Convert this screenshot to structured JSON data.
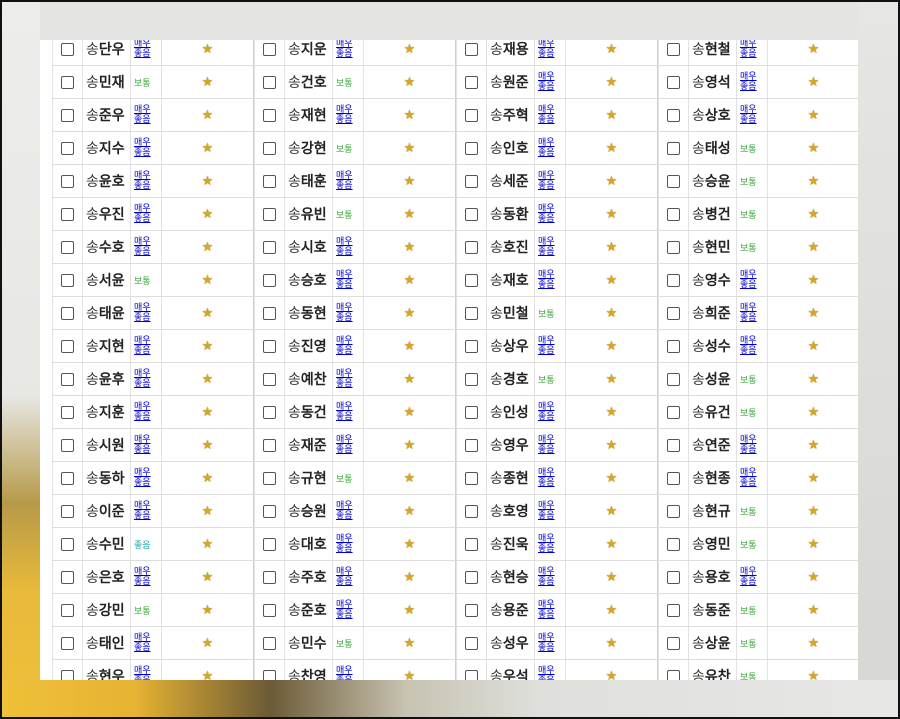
{
  "surname": "송",
  "rating_labels": {
    "very_good_1": "매우",
    "very_good_2": "좋음",
    "normal": "보통",
    "good": "좋음"
  },
  "columns": [
    [
      {
        "name": "단우",
        "rating": "vg"
      },
      {
        "name": "민재",
        "rating": "n"
      },
      {
        "name": "준우",
        "rating": "vg"
      },
      {
        "name": "지수",
        "rating": "vg"
      },
      {
        "name": "윤호",
        "rating": "vg"
      },
      {
        "name": "우진",
        "rating": "vg"
      },
      {
        "name": "수호",
        "rating": "vg"
      },
      {
        "name": "서윤",
        "rating": "n"
      },
      {
        "name": "태윤",
        "rating": "vg"
      },
      {
        "name": "지현",
        "rating": "vg"
      },
      {
        "name": "윤후",
        "rating": "vg"
      },
      {
        "name": "지훈",
        "rating": "vg"
      },
      {
        "name": "시원",
        "rating": "vg"
      },
      {
        "name": "동하",
        "rating": "vg"
      },
      {
        "name": "이준",
        "rating": "vg"
      },
      {
        "name": "수민",
        "rating": "g"
      },
      {
        "name": "은호",
        "rating": "vg"
      },
      {
        "name": "강민",
        "rating": "n"
      },
      {
        "name": "태인",
        "rating": "vg"
      },
      {
        "name": "현우",
        "rating": "vg"
      }
    ],
    [
      {
        "name": "지운",
        "rating": "vg"
      },
      {
        "name": "건호",
        "rating": "n"
      },
      {
        "name": "재현",
        "rating": "vg"
      },
      {
        "name": "강현",
        "rating": "n"
      },
      {
        "name": "태훈",
        "rating": "vg"
      },
      {
        "name": "유빈",
        "rating": "n"
      },
      {
        "name": "시호",
        "rating": "vg"
      },
      {
        "name": "승호",
        "rating": "vg"
      },
      {
        "name": "동현",
        "rating": "vg"
      },
      {
        "name": "진영",
        "rating": "vg"
      },
      {
        "name": "예찬",
        "rating": "vg"
      },
      {
        "name": "동건",
        "rating": "vg"
      },
      {
        "name": "재준",
        "rating": "vg"
      },
      {
        "name": "규현",
        "rating": "n"
      },
      {
        "name": "승원",
        "rating": "vg"
      },
      {
        "name": "대호",
        "rating": "vg"
      },
      {
        "name": "주호",
        "rating": "vg"
      },
      {
        "name": "준호",
        "rating": "vg"
      },
      {
        "name": "민수",
        "rating": "n"
      },
      {
        "name": "찬영",
        "rating": "vg"
      }
    ],
    [
      {
        "name": "재용",
        "rating": "vg"
      },
      {
        "name": "원준",
        "rating": "vg"
      },
      {
        "name": "주혁",
        "rating": "vg"
      },
      {
        "name": "인호",
        "rating": "vg"
      },
      {
        "name": "세준",
        "rating": "vg"
      },
      {
        "name": "동환",
        "rating": "vg"
      },
      {
        "name": "호진",
        "rating": "vg"
      },
      {
        "name": "재호",
        "rating": "vg"
      },
      {
        "name": "민철",
        "rating": "n"
      },
      {
        "name": "상우",
        "rating": "vg"
      },
      {
        "name": "경호",
        "rating": "n"
      },
      {
        "name": "인성",
        "rating": "vg"
      },
      {
        "name": "영우",
        "rating": "vg"
      },
      {
        "name": "종현",
        "rating": "vg"
      },
      {
        "name": "호영",
        "rating": "vg"
      },
      {
        "name": "진욱",
        "rating": "vg"
      },
      {
        "name": "현승",
        "rating": "vg"
      },
      {
        "name": "용준",
        "rating": "vg"
      },
      {
        "name": "성우",
        "rating": "vg"
      },
      {
        "name": "우석",
        "rating": "vg"
      }
    ],
    [
      {
        "name": "현철",
        "rating": "vg"
      },
      {
        "name": "영석",
        "rating": "vg"
      },
      {
        "name": "상호",
        "rating": "vg"
      },
      {
        "name": "태성",
        "rating": "n"
      },
      {
        "name": "승윤",
        "rating": "n"
      },
      {
        "name": "병건",
        "rating": "n"
      },
      {
        "name": "현민",
        "rating": "n"
      },
      {
        "name": "영수",
        "rating": "vg"
      },
      {
        "name": "희준",
        "rating": "vg"
      },
      {
        "name": "성수",
        "rating": "vg"
      },
      {
        "name": "성윤",
        "rating": "n"
      },
      {
        "name": "유건",
        "rating": "n"
      },
      {
        "name": "연준",
        "rating": "vg"
      },
      {
        "name": "현종",
        "rating": "vg"
      },
      {
        "name": "현규",
        "rating": "n"
      },
      {
        "name": "영민",
        "rating": "n"
      },
      {
        "name": "용호",
        "rating": "vg"
      },
      {
        "name": "동준",
        "rating": "n"
      },
      {
        "name": "상윤",
        "rating": "n"
      },
      {
        "name": "유찬",
        "rating": "n"
      }
    ]
  ],
  "colors": {
    "very_good": "#0000cc",
    "normal": "#3aa63a",
    "good": "#19a8a8",
    "star": "#d9a61e"
  },
  "icons": {
    "star": "star-icon",
    "checkbox": "checkbox"
  }
}
